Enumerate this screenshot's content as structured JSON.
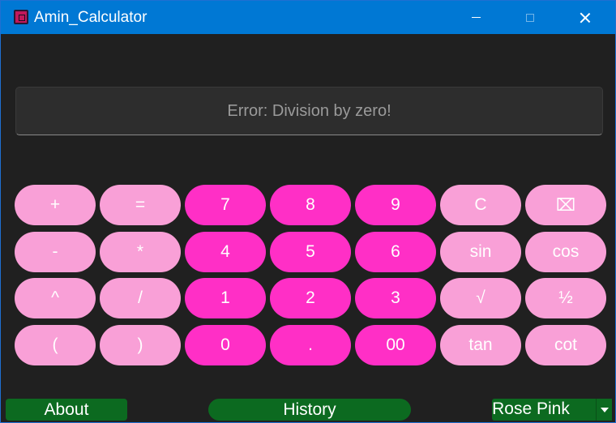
{
  "window": {
    "title": "Amin_Calculator"
  },
  "display": {
    "text": "Error: Division by zero!"
  },
  "keypad": {
    "rows": [
      [
        {
          "label": "+",
          "style": "light"
        },
        {
          "label": "=",
          "style": "light"
        },
        {
          "label": "7",
          "style": "hot"
        },
        {
          "label": "8",
          "style": "hot"
        },
        {
          "label": "9",
          "style": "hot"
        },
        {
          "label": "C",
          "style": "light"
        },
        {
          "label": "⌧",
          "style": "light"
        }
      ],
      [
        {
          "label": "-",
          "style": "light"
        },
        {
          "label": "*",
          "style": "light"
        },
        {
          "label": "4",
          "style": "hot"
        },
        {
          "label": "5",
          "style": "hot"
        },
        {
          "label": "6",
          "style": "hot"
        },
        {
          "label": "sin",
          "style": "light"
        },
        {
          "label": "cos",
          "style": "light"
        }
      ],
      [
        {
          "label": "^",
          "style": "light"
        },
        {
          "label": "/",
          "style": "light"
        },
        {
          "label": "1",
          "style": "hot"
        },
        {
          "label": "2",
          "style": "hot"
        },
        {
          "label": "3",
          "style": "hot"
        },
        {
          "label": "√",
          "style": "light"
        },
        {
          "label": "½",
          "style": "light"
        }
      ],
      [
        {
          "label": "(",
          "style": "light"
        },
        {
          "label": ")",
          "style": "light"
        },
        {
          "label": "0",
          "style": "hot"
        },
        {
          "label": ".",
          "style": "hot"
        },
        {
          "label": "00",
          "style": "hot"
        },
        {
          "label": "tan",
          "style": "light"
        },
        {
          "label": "cot",
          "style": "light"
        }
      ]
    ]
  },
  "bottom": {
    "about_label": "About",
    "history_label": "History",
    "theme_selected": "Rose Pink"
  },
  "colors": {
    "titlebar": "#0078d4",
    "background": "#202020",
    "key_light": "#f9a0d7",
    "key_hot": "#ff2fc6",
    "button_green": "#0c6a20"
  }
}
